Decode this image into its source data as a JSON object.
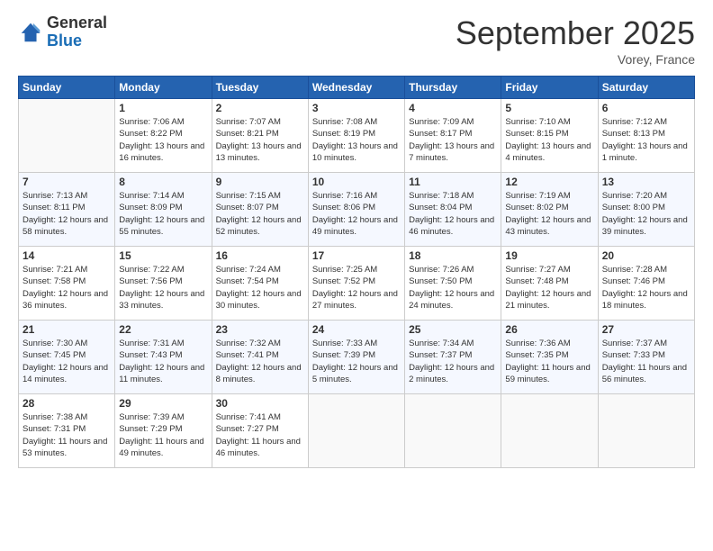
{
  "logo": {
    "general": "General",
    "blue": "Blue"
  },
  "title": "September 2025",
  "location": "Vorey, France",
  "days_of_week": [
    "Sunday",
    "Monday",
    "Tuesday",
    "Wednesday",
    "Thursday",
    "Friday",
    "Saturday"
  ],
  "weeks": [
    [
      {
        "day": "",
        "sunrise": "",
        "sunset": "",
        "daylight": ""
      },
      {
        "day": "1",
        "sunrise": "Sunrise: 7:06 AM",
        "sunset": "Sunset: 8:22 PM",
        "daylight": "Daylight: 13 hours and 16 minutes."
      },
      {
        "day": "2",
        "sunrise": "Sunrise: 7:07 AM",
        "sunset": "Sunset: 8:21 PM",
        "daylight": "Daylight: 13 hours and 13 minutes."
      },
      {
        "day": "3",
        "sunrise": "Sunrise: 7:08 AM",
        "sunset": "Sunset: 8:19 PM",
        "daylight": "Daylight: 13 hours and 10 minutes."
      },
      {
        "day": "4",
        "sunrise": "Sunrise: 7:09 AM",
        "sunset": "Sunset: 8:17 PM",
        "daylight": "Daylight: 13 hours and 7 minutes."
      },
      {
        "day": "5",
        "sunrise": "Sunrise: 7:10 AM",
        "sunset": "Sunset: 8:15 PM",
        "daylight": "Daylight: 13 hours and 4 minutes."
      },
      {
        "day": "6",
        "sunrise": "Sunrise: 7:12 AM",
        "sunset": "Sunset: 8:13 PM",
        "daylight": "Daylight: 13 hours and 1 minute."
      }
    ],
    [
      {
        "day": "7",
        "sunrise": "Sunrise: 7:13 AM",
        "sunset": "Sunset: 8:11 PM",
        "daylight": "Daylight: 12 hours and 58 minutes."
      },
      {
        "day": "8",
        "sunrise": "Sunrise: 7:14 AM",
        "sunset": "Sunset: 8:09 PM",
        "daylight": "Daylight: 12 hours and 55 minutes."
      },
      {
        "day": "9",
        "sunrise": "Sunrise: 7:15 AM",
        "sunset": "Sunset: 8:07 PM",
        "daylight": "Daylight: 12 hours and 52 minutes."
      },
      {
        "day": "10",
        "sunrise": "Sunrise: 7:16 AM",
        "sunset": "Sunset: 8:06 PM",
        "daylight": "Daylight: 12 hours and 49 minutes."
      },
      {
        "day": "11",
        "sunrise": "Sunrise: 7:18 AM",
        "sunset": "Sunset: 8:04 PM",
        "daylight": "Daylight: 12 hours and 46 minutes."
      },
      {
        "day": "12",
        "sunrise": "Sunrise: 7:19 AM",
        "sunset": "Sunset: 8:02 PM",
        "daylight": "Daylight: 12 hours and 43 minutes."
      },
      {
        "day": "13",
        "sunrise": "Sunrise: 7:20 AM",
        "sunset": "Sunset: 8:00 PM",
        "daylight": "Daylight: 12 hours and 39 minutes."
      }
    ],
    [
      {
        "day": "14",
        "sunrise": "Sunrise: 7:21 AM",
        "sunset": "Sunset: 7:58 PM",
        "daylight": "Daylight: 12 hours and 36 minutes."
      },
      {
        "day": "15",
        "sunrise": "Sunrise: 7:22 AM",
        "sunset": "Sunset: 7:56 PM",
        "daylight": "Daylight: 12 hours and 33 minutes."
      },
      {
        "day": "16",
        "sunrise": "Sunrise: 7:24 AM",
        "sunset": "Sunset: 7:54 PM",
        "daylight": "Daylight: 12 hours and 30 minutes."
      },
      {
        "day": "17",
        "sunrise": "Sunrise: 7:25 AM",
        "sunset": "Sunset: 7:52 PM",
        "daylight": "Daylight: 12 hours and 27 minutes."
      },
      {
        "day": "18",
        "sunrise": "Sunrise: 7:26 AM",
        "sunset": "Sunset: 7:50 PM",
        "daylight": "Daylight: 12 hours and 24 minutes."
      },
      {
        "day": "19",
        "sunrise": "Sunrise: 7:27 AM",
        "sunset": "Sunset: 7:48 PM",
        "daylight": "Daylight: 12 hours and 21 minutes."
      },
      {
        "day": "20",
        "sunrise": "Sunrise: 7:28 AM",
        "sunset": "Sunset: 7:46 PM",
        "daylight": "Daylight: 12 hours and 18 minutes."
      }
    ],
    [
      {
        "day": "21",
        "sunrise": "Sunrise: 7:30 AM",
        "sunset": "Sunset: 7:45 PM",
        "daylight": "Daylight: 12 hours and 14 minutes."
      },
      {
        "day": "22",
        "sunrise": "Sunrise: 7:31 AM",
        "sunset": "Sunset: 7:43 PM",
        "daylight": "Daylight: 12 hours and 11 minutes."
      },
      {
        "day": "23",
        "sunrise": "Sunrise: 7:32 AM",
        "sunset": "Sunset: 7:41 PM",
        "daylight": "Daylight: 12 hours and 8 minutes."
      },
      {
        "day": "24",
        "sunrise": "Sunrise: 7:33 AM",
        "sunset": "Sunset: 7:39 PM",
        "daylight": "Daylight: 12 hours and 5 minutes."
      },
      {
        "day": "25",
        "sunrise": "Sunrise: 7:34 AM",
        "sunset": "Sunset: 7:37 PM",
        "daylight": "Daylight: 12 hours and 2 minutes."
      },
      {
        "day": "26",
        "sunrise": "Sunrise: 7:36 AM",
        "sunset": "Sunset: 7:35 PM",
        "daylight": "Daylight: 11 hours and 59 minutes."
      },
      {
        "day": "27",
        "sunrise": "Sunrise: 7:37 AM",
        "sunset": "Sunset: 7:33 PM",
        "daylight": "Daylight: 11 hours and 56 minutes."
      }
    ],
    [
      {
        "day": "28",
        "sunrise": "Sunrise: 7:38 AM",
        "sunset": "Sunset: 7:31 PM",
        "daylight": "Daylight: 11 hours and 53 minutes."
      },
      {
        "day": "29",
        "sunrise": "Sunrise: 7:39 AM",
        "sunset": "Sunset: 7:29 PM",
        "daylight": "Daylight: 11 hours and 49 minutes."
      },
      {
        "day": "30",
        "sunrise": "Sunrise: 7:41 AM",
        "sunset": "Sunset: 7:27 PM",
        "daylight": "Daylight: 11 hours and 46 minutes."
      },
      {
        "day": "",
        "sunrise": "",
        "sunset": "",
        "daylight": ""
      },
      {
        "day": "",
        "sunrise": "",
        "sunset": "",
        "daylight": ""
      },
      {
        "day": "",
        "sunrise": "",
        "sunset": "",
        "daylight": ""
      },
      {
        "day": "",
        "sunrise": "",
        "sunset": "",
        "daylight": ""
      }
    ]
  ]
}
